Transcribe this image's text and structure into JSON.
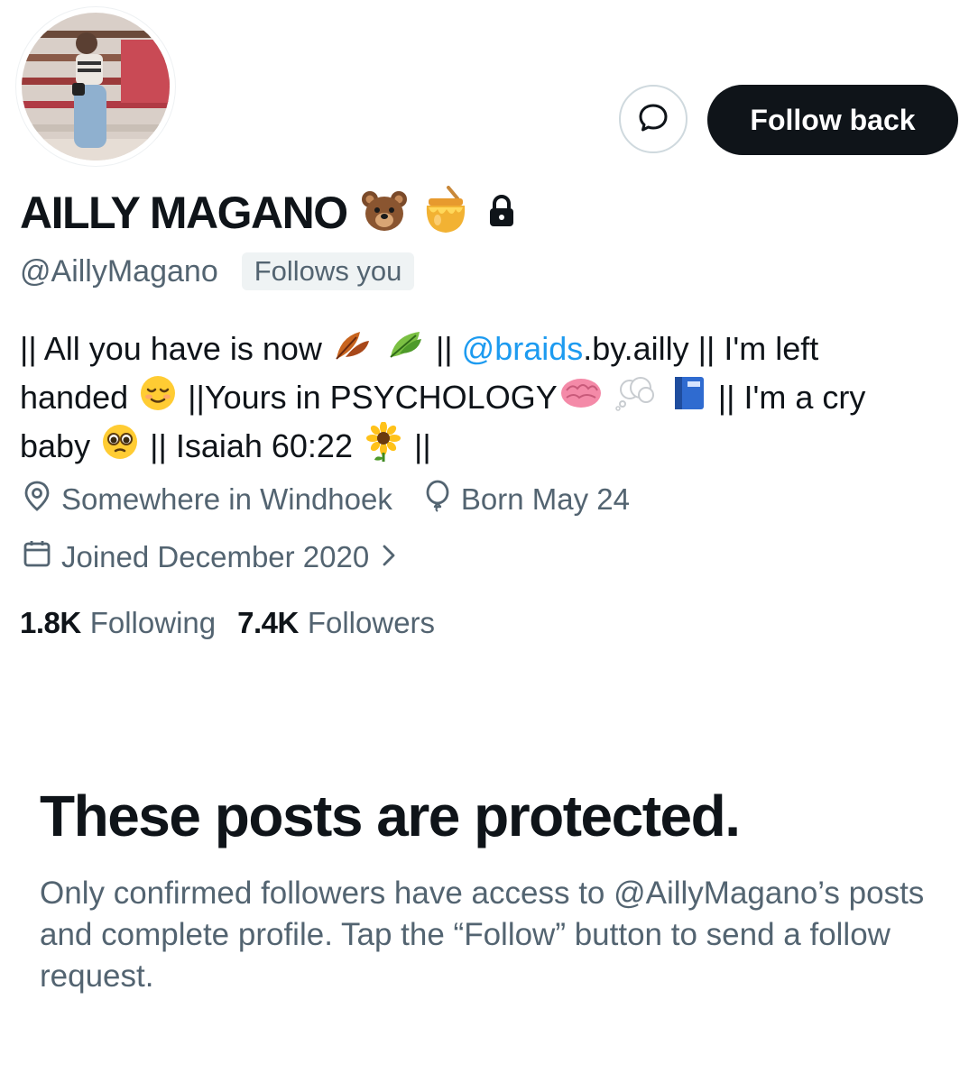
{
  "profile": {
    "display_name": "AILLY MAGANO",
    "handle": "@AillyMagano",
    "follows_you": "Follows you",
    "name_emoji": [
      "bear",
      "honey-pot"
    ],
    "locked": true
  },
  "actions": {
    "follow_back": "Follow back",
    "message_icon": "message-icon"
  },
  "bio": {
    "line1_a": "|| All you have is now",
    "line1_b": "|| ",
    "line1_link": "@braids",
    "line1_c": ".by.ailly || I'm left",
    "line2_a": "handed",
    "line2_b": "||Yours in PSYCHOLOGY",
    "line2_c": "|| I'm a cry",
    "line3_a": "baby",
    "line3_b": "|| Isaiah 60:22",
    "line3_c": "||"
  },
  "meta": {
    "location": "Somewhere in Windhoek",
    "birthday": "Born May 24",
    "joined": "Joined December 2020",
    "chevron": ">"
  },
  "stats": {
    "following_count": "1.8K",
    "following_label": "Following",
    "followers_count": "7.4K",
    "followers_label": "Followers"
  },
  "protected": {
    "title": "These posts are protected.",
    "description": "Only confirmed followers have access to @AillyMagano’s posts and complete profile. Tap the “Follow” button to send a follow request."
  },
  "colors": {
    "link": "#1d9bf0",
    "secondary_text": "#536471",
    "primary_text": "#0f1419",
    "button_bg": "#0f1419",
    "badge_bg": "#eff3f4"
  }
}
